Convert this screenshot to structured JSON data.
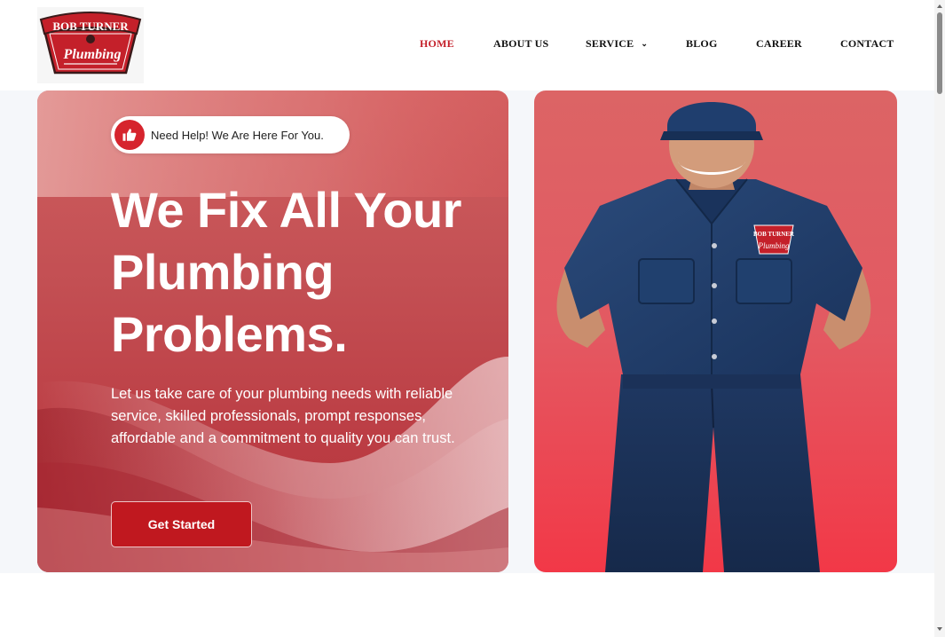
{
  "logo": {
    "line1": "BOB TURNER",
    "line2": "Plumbing"
  },
  "nav": {
    "items": [
      {
        "label": "HOME",
        "active": true
      },
      {
        "label": "ABOUT US",
        "active": false
      },
      {
        "label": "SERVICE",
        "active": false,
        "dropdown": true
      },
      {
        "label": "BLOG",
        "active": false
      },
      {
        "label": "CAREER",
        "active": false
      },
      {
        "label": "CONTACT",
        "active": false
      }
    ]
  },
  "hero": {
    "badge_text": "Need Help! We Are Here For You.",
    "headline_line1": "We Fix All Your",
    "headline_line2": "Plumbing",
    "headline_line3": "Problems.",
    "subtext": "Let us take care of your plumbing needs with reliable service, skilled professionals, prompt responses, affordable and a commitment to quality you can trust.",
    "cta_label": "Get Started"
  },
  "worker_patch": {
    "line1": "BOB TURNER",
    "line2": "Plumbing"
  },
  "colors": {
    "accent": "#c4202a",
    "card_left": "#c34f53",
    "card_right": "#e35962",
    "uniform": "#1f3862"
  },
  "icons": {
    "badge": "thumbs-up-icon",
    "service_dropdown": "chevron-down-icon"
  }
}
